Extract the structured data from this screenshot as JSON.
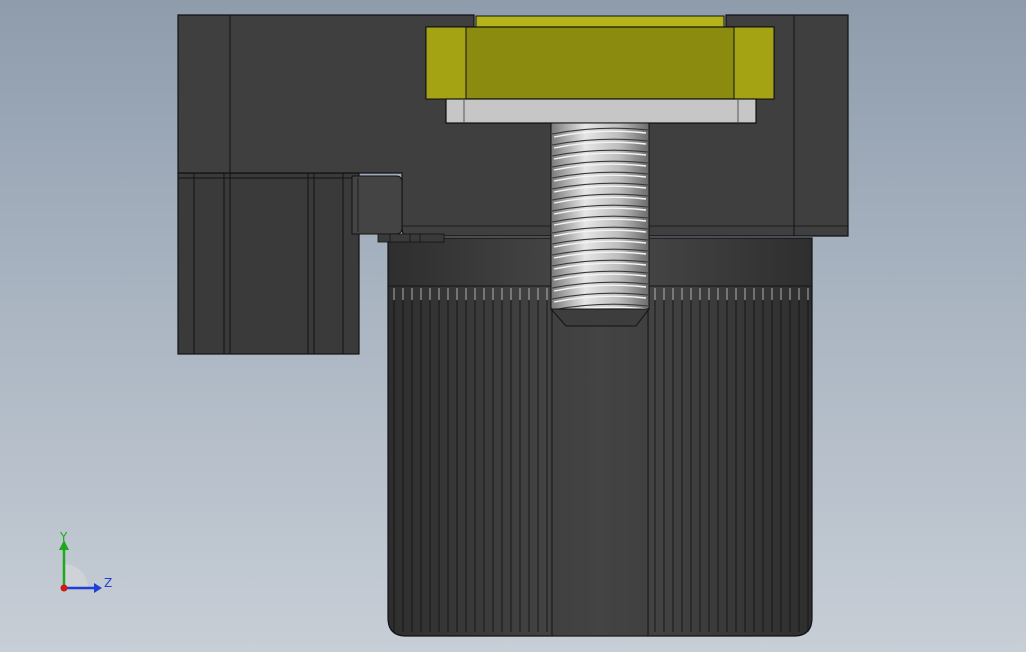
{
  "viewport": {
    "background_top": "#8e9cac",
    "background_bottom": "#c7ced6"
  },
  "model": {
    "colors": {
      "housing": "#3e3e3e",
      "housing_light": "#4a4a4a",
      "edge": "#121212",
      "washer": "#c8c8c8",
      "nut_face": "#8f8f12",
      "nut_edge": "#b8b81c",
      "thread": "#d8d8d8",
      "thread_dark": "#6e6e6e"
    }
  },
  "triad": {
    "y_label": "Y",
    "z_label": "Z",
    "y_color": "#1fa81f",
    "z_color": "#1f3fd8",
    "origin_color": "#d01818"
  }
}
